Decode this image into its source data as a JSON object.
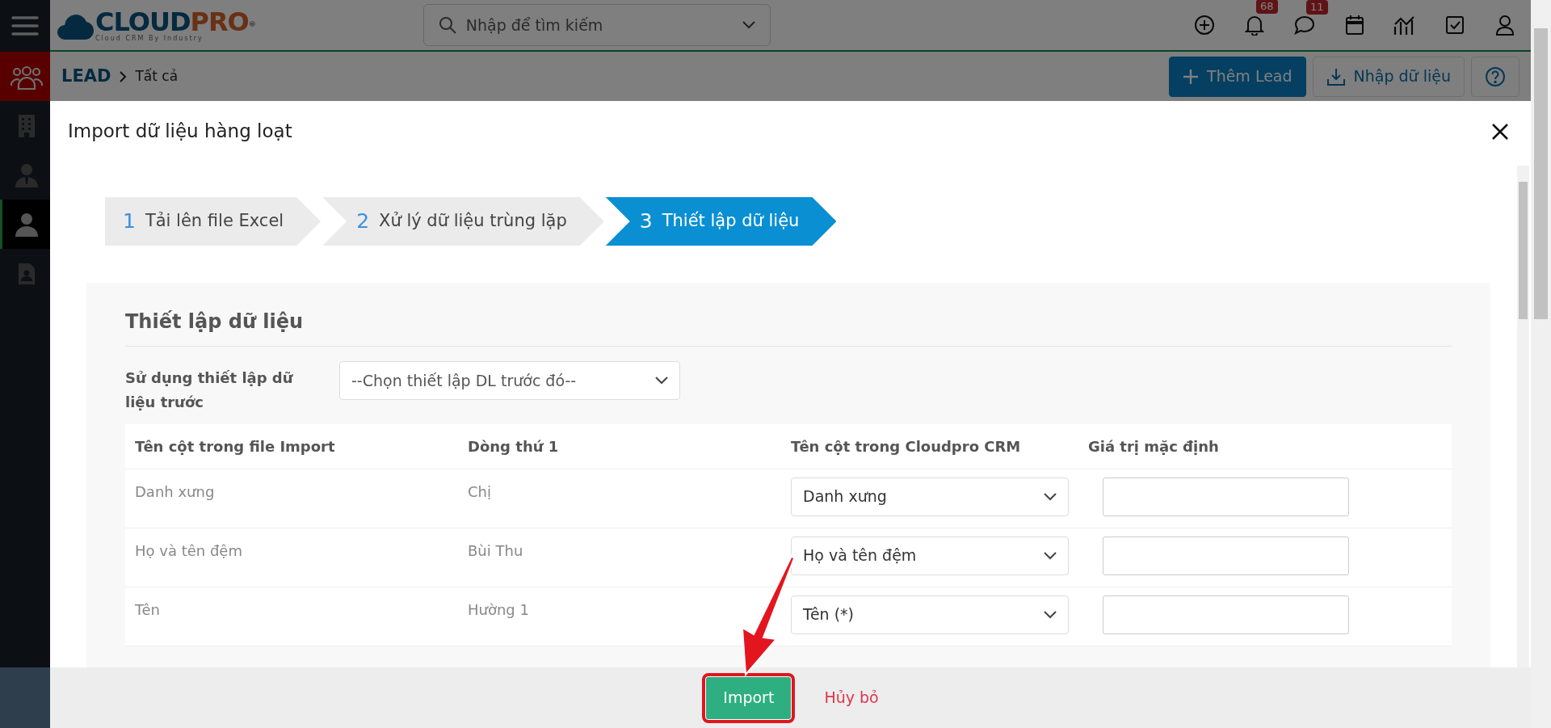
{
  "logo": {
    "primary": "CLOUD",
    "accent": "PRO",
    "mark": "®",
    "tagline": "Cloud CRM By Industry"
  },
  "search": {
    "placeholder": "Nhập để tìm kiếm"
  },
  "header_icons": [
    {
      "kind": "add"
    },
    {
      "kind": "bell",
      "badge": "68"
    },
    {
      "kind": "chat",
      "badge": "11"
    },
    {
      "kind": "calendar"
    },
    {
      "kind": "chart"
    },
    {
      "kind": "task"
    },
    {
      "kind": "user"
    }
  ],
  "sidebar": {
    "items": [
      {
        "kind": "people",
        "module": true,
        "selected": false
      },
      {
        "kind": "building",
        "module": false,
        "selected": false
      },
      {
        "kind": "contact",
        "module": false,
        "selected": false
      },
      {
        "kind": "person",
        "module": false,
        "selected": true
      },
      {
        "kind": "document",
        "module": false,
        "selected": false
      }
    ]
  },
  "breadcrumb": {
    "module": "LEAD",
    "view": "Tất cả"
  },
  "actions": [
    {
      "kind": "add",
      "label": "Thêm Lead"
    },
    {
      "kind": "import",
      "label": "Nhập dữ liệu"
    },
    {
      "kind": "help"
    }
  ],
  "modal": {
    "title": "Import dữ liệu hàng loạt",
    "steps": [
      {
        "number": "1",
        "label": "Tải lên file Excel",
        "selected": false
      },
      {
        "number": "2",
        "label": "Xử lý dữ liệu trùng lặp",
        "selected": false
      },
      {
        "number": "3",
        "label": "Thiết lập dữ liệu",
        "selected": true
      }
    ],
    "panel_title": "Thiết lập dữ liệu",
    "preset": {
      "label": "Sử dụng thiết lập dữ liệu trước",
      "value": "--Chọn thiết lập DL trước đó--"
    },
    "table": {
      "columns": [
        "Tên cột trong file Import",
        "Dòng thứ 1",
        "Tên cột trong Cloudpro CRM",
        "Giá trị mặc định"
      ],
      "rows": [
        {
          "import_column": "Danh xưng",
          "first_row": "Chị",
          "crm_field": "Danh xưng"
        },
        {
          "import_column": "Họ và tên đệm",
          "first_row": "Bùi Thu",
          "crm_field": "Họ và tên đệm"
        },
        {
          "import_column": "Tên",
          "first_row": "Hường 1",
          "crm_field": "Tên  (*)"
        }
      ]
    },
    "footer": {
      "import_button": "Import",
      "cancel_link": "Hủy bỏ"
    }
  }
}
